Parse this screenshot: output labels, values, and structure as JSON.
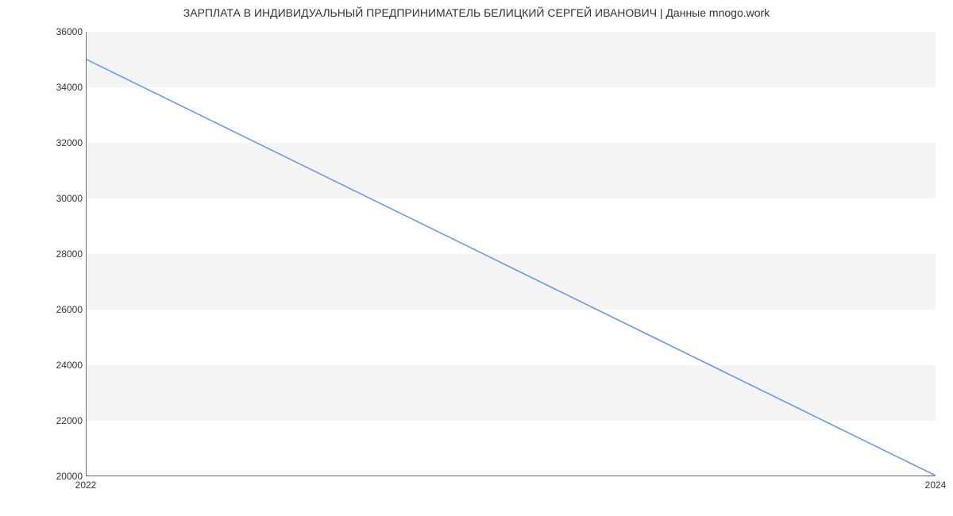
{
  "chart_data": {
    "type": "line",
    "title": "ЗАРПЛАТА В ИНДИВИДУАЛЬНЫЙ ПРЕДПРИНИМАТЕЛЬ БЕЛИЦКИЙ СЕРГЕЙ ИВАНОВИЧ | Данные mnogo.work",
    "x": [
      2022,
      2024
    ],
    "values": [
      35000,
      20000
    ],
    "xlabel": "",
    "ylabel": "",
    "x_ticks": [
      2022,
      2024
    ],
    "y_ticks": [
      20000,
      22000,
      24000,
      26000,
      28000,
      30000,
      32000,
      34000,
      36000
    ],
    "xlim": [
      2022,
      2024
    ],
    "ylim": [
      20000,
      36000
    ],
    "line_color": "#6c9ae0"
  }
}
